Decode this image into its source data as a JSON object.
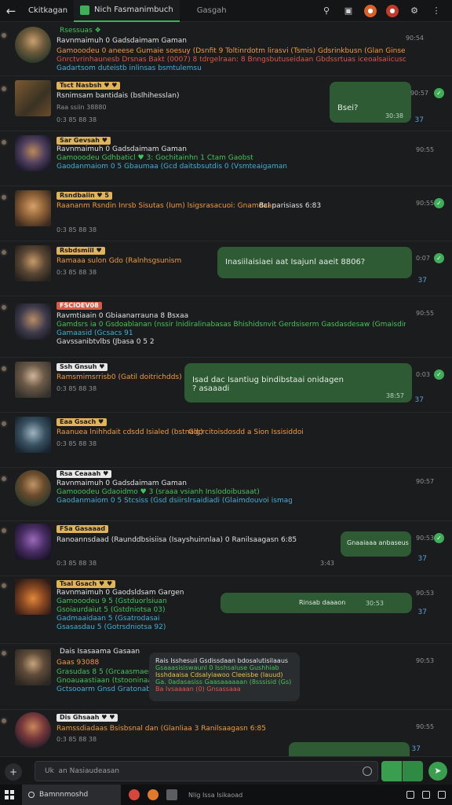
{
  "topbar": {
    "back_icon": "back-arrow-icon",
    "tab1": "Ckitkagan",
    "tab2": "Nich Fasmanimbuch",
    "tab3": "Gasgah"
  },
  "messages": [
    {
      "badge": "Rsessuas ❖",
      "title": "Ravnmaimuh 0 Gadsdaimam Gaman",
      "lines": [
        "Gamooodeu 0 aneese Gumaie soesuy (Dsnfit 9 Toltinrdotm lirasvi (Tsmis)  Gdsrinkbusn (Glan Ginseudatoman",
        "Gnrctvrinhaunesb Drsnas Bakt (0007) 8 tdrgelraan: 8 Bnngsbutuseidaan Gbdssrtuas iceoalsaiicuson lkhis",
        "Gadartsom duteistb inlinsas bsmtulemsu"
      ],
      "time": "90:54"
    },
    {
      "badge": "Tsct Nasbsh ♥ ♥",
      "title": "Rsnimsam bantidais (bslhihesslan)",
      "lines": [
        "Raa ssiin 38880"
      ],
      "time": "0:3 85 88 38",
      "bubble": "Bsei?",
      "bubble_time": "30:38",
      "side_time": "90:57",
      "side_num": "37"
    },
    {
      "badge": "Sar Gevsah ♥",
      "title": "Ravnmaimuh 0 Gadsdaimam Gaman",
      "lines": [
        "Gamooodeu Gdhbaticl ♥ 3: Gochitainhn 1 Ctam Gaobst",
        "Gaodanmaiom 0 5 Gbaumaa (Gcd daitsbsutdis 0 (Vsmteaigaman"
      ],
      "time": "90:55"
    },
    {
      "badge": "Rsndbaiin ♥ 5",
      "title": "Raananm Rsndin  Inrsb Sisutas (Ium) lsigsrasacuoi:  Gnamdaan",
      "lines": [
        "0:3 85 88 38"
      ],
      "time": "90:55",
      "tail": "Bcl parisiass 6:83"
    },
    {
      "badge": "Rsbdsmiil ♥",
      "title": "Ramaaa sulon Gdo (Ralnhsgsunism",
      "lines": [
        "0:3 85 88 38"
      ],
      "time": "0:07",
      "bubble": "Inasiilaisiaei aat Isajunl  aaeit 8806?",
      "side_num": "37"
    },
    {
      "badge": "FSCIOEV08",
      "title": "Ravmtiaain 0 Gbiaanarrauna 8 Bsxaa",
      "lines": [
        "Gamdsrs ia 0 Gsdoablanan (nssir Inidiralinabasas Bhishidsnvit Gerdsiserm  Gasdasdesaw (Gmaisdinsdi)",
        "Gamaasid (Gcsacs 91",
        "Gavssanibtvlbs (Jbasa 0 5 2"
      ],
      "time": "90:55"
    },
    {
      "badge": "Ssh Gnsuh ♥",
      "title": "Ramsmimsrrisb0 (Gatil doitrichdds)",
      "lines": [
        "0:3 85 88 38"
      ],
      "time": "0:03",
      "bubble": "Isad dac Isantiug bindibstaai onidagen ?  asaaadi",
      "bubble_time": "38:57",
      "side_num": "37"
    },
    {
      "badge": "Eaa Gsach ♥",
      "title": "Raanuea lnihhdait  cdsdd Isialed (bstnalg)",
      "lines": [
        "0:3 85 88 38"
      ],
      "time": "",
      "tail": "Gdcrcitoisdosdd a Sion Issisiddoi"
    },
    {
      "badge": "Rsa Ceaaah ♥",
      "title": "Ravnmaimuh 0 Gadsdaimam Gaman",
      "lines": [
        "Gamooodeu Gdaoidmo ♥ 3  (sraaa vsianh Inslodoibusaat)",
        "Gaodanmaiom 0 5 Stcsiss (Gsd dsiirslrsaidiadi  (Glaimdouvoi ismaggaisan"
      ],
      "time": "90:57"
    },
    {
      "badge": "FSa Gasaaad",
      "title": "Ranoannsdaad (Raunddbsisiisa (Isayshuinnlaa) 0  Ranilsaagasn 6:85",
      "lines": [
        "0:3 85 88 38"
      ],
      "time": "90:53",
      "bubble": "Gnaaiaaa anbaseus",
      "bubble_time": "3:43",
      "side_num": "37"
    },
    {
      "badge": "Tsal Gsach ♥ ♥",
      "title": "Ravnmaimuh 0 Gaodsldsam Gargen",
      "lines": [
        "Gamooodeu 9 5 (Gstduorlsiuan",
        "Gsoiaurdaiut 5 (Gstdniotsa 03)",
        "Gadmaaidaan 5 (Gsatrodasai",
        "Gsasasdau 5 (Gotrsdniotsa 92)"
      ],
      "time": "90:53",
      "bubble": "Rinsab daaaon",
      "bubble_time": "30:53",
      "side_num": "37"
    },
    {
      "badge": "Dais Isasaama Gasaan",
      "title": "Gaas 93088",
      "lines": [
        "Grasudas 8 5 (Grcaasmaen",
        "Gnoauaastiaan (tstooninaaan",
        "Gctsooarm Gnsd Gratonabrsanl"
      ],
      "time": "90:53",
      "panel": [
        "Rais Isshesuii Gsdissdaan bdosalutisilaaus",
        "Gsaaasisiswaunl 0 Isshsaluse Gushhiab",
        "Isshdaaisa Cdsalyiawoo Cleeisbe (Iauud)",
        "Ga. 0adasasiss Gaasaaaaaan (8sssisid (Gs)",
        "Ba Ivsaaaan (0)  Gnsassaaa"
      ]
    },
    {
      "badge": "Dis Ghsaah ♥ ♥",
      "title": "Ramssdiadaas Bsisbsnal dan (Glanliaa 3  Ranilsaagasn 6:85",
      "lines": [
        "0:3 85 88 38"
      ],
      "time": "90:55",
      "side_num": "37"
    }
  ],
  "input": {
    "placeholder": "Uk  an Nasiaudeasan",
    "plus_icon": "plus-icon",
    "emoji_icon": "smile-icon",
    "send_icon": "send-icon"
  },
  "taskbar": {
    "search_label": "Bamnnmoshd",
    "tray_label": "Nlig Issa Isikaoad"
  },
  "colors": {
    "accent_green": "#3fae59",
    "bubble_green": "#2e5a34",
    "bg": "#1b1c1e"
  }
}
